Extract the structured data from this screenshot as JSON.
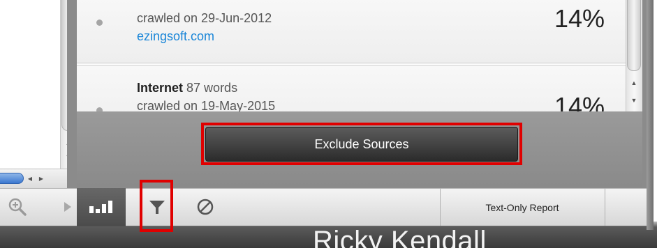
{
  "sources": [
    {
      "title": "",
      "word_count": "",
      "crawled": "crawled on 29-Jun-2012",
      "link": "ezingsoft.com",
      "percent": "14%"
    },
    {
      "title": "Internet",
      "word_count": "87 words",
      "crawled": "crawled on 19-May-2015",
      "link": "",
      "percent": "14%"
    }
  ],
  "actions": {
    "exclude_label": "Exclude Sources"
  },
  "toolbar": {
    "text_only_label": "Text-Only Report",
    "icons": [
      "zoom-in-icon",
      "play-icon",
      "bar-chart-icon",
      "filter-icon",
      "block-icon"
    ]
  },
  "background": {
    "name_fragment": "Ricky Kendall"
  },
  "colors": {
    "link": "#1a86d8",
    "highlight": "#e00000",
    "button": "#3a3a3a"
  }
}
